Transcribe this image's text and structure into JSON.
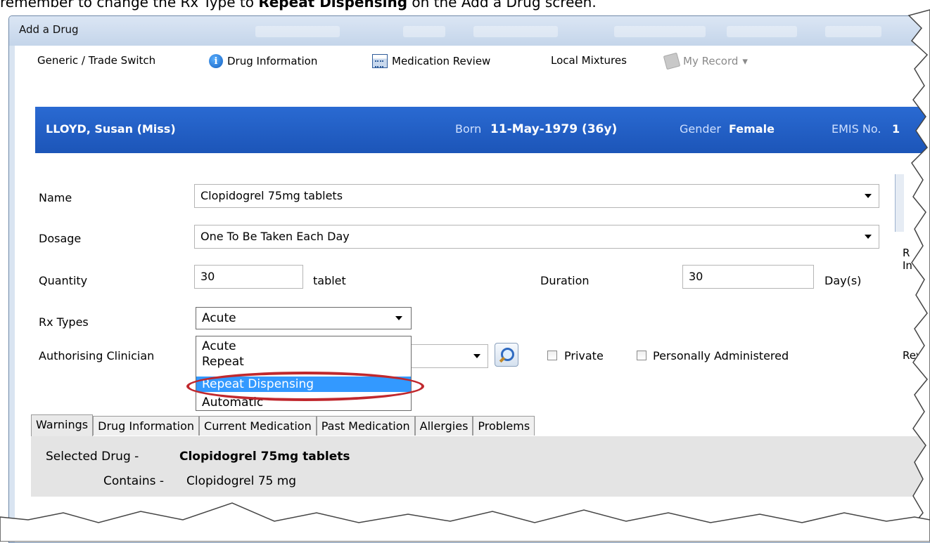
{
  "caption": {
    "prefix": "remember to change the Rx Type to ",
    "emphasis": "Repeat Dispensing",
    "suffix": " on the Add a Drug screen."
  },
  "window": {
    "title": "Add a Drug"
  },
  "toolbar": {
    "generic_trade": "Generic / Trade Switch",
    "drug_information": "Drug Information",
    "medication_review": "Medication Review",
    "local_mixtures": "Local Mixtures",
    "my_record": "My Record",
    "my_record_caret": "▾"
  },
  "patient": {
    "name": "LLOYD, Susan (Miss)",
    "born_label": "Born",
    "born_value": "11-May-1979 (36y)",
    "gender_label": "Gender",
    "gender_value": "Female",
    "emis_label": "EMIS No.",
    "emis_value": "1"
  },
  "form": {
    "name_label": "Name",
    "name_value": "Clopidogrel 75mg tablets",
    "dosage_label": "Dosage",
    "dosage_value": "One To Be Taken Each Day",
    "quantity_label": "Quantity",
    "quantity_value": "30",
    "quantity_unit": "tablet",
    "duration_label": "Duration",
    "duration_value": "30",
    "duration_unit": "Day(s)",
    "rx_types_label": "Rx Types",
    "rx_selected": "Acute",
    "rx_options": [
      "Acute",
      "Repeat",
      "Repeat Dispensing",
      "Automatic"
    ],
    "rx_highlighted": "Repeat Dispensing",
    "authorising_label": "Authorising Clinician",
    "private_label": "Private",
    "personally_administered_label": "Personally Administered"
  },
  "side_fragments": {
    "r": "R",
    "in": "In",
    "rev": "Rev"
  },
  "tabs": [
    "Warnings",
    "Drug Information",
    "Current Medication",
    "Past Medication",
    "Allergies",
    "Problems"
  ],
  "active_tab": "Warnings",
  "warnings": {
    "selected_label": "Selected Drug -",
    "selected_value": "Clopidogrel 75mg tablets",
    "contains_label": "Contains -",
    "contains_value": "Clopidogrel 75 mg"
  },
  "colors": {
    "banner": "#1f5bbf",
    "highlight_ring": "#c0282d",
    "selection": "#3399ff"
  }
}
